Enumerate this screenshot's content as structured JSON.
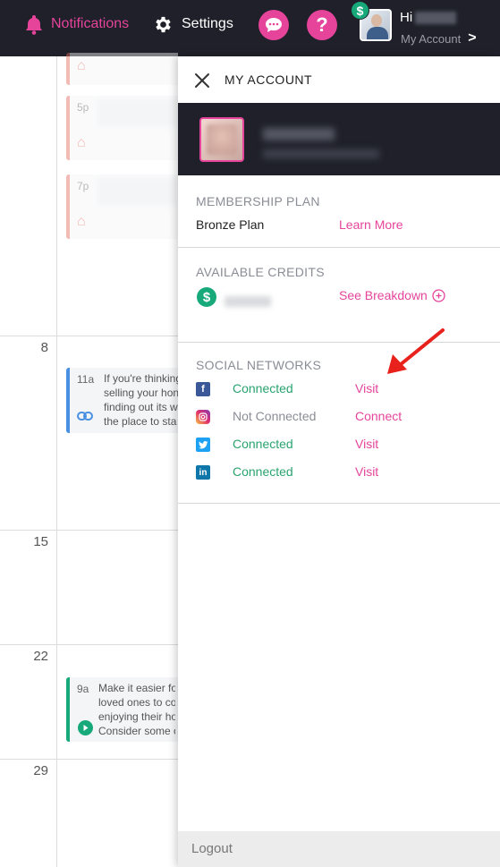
{
  "topbar": {
    "notifications_label": "Notifications",
    "settings_label": "Settings",
    "greeting": "Hi",
    "my_account_label": "My Account",
    "help_symbol": "?",
    "dollar_symbol": "$",
    "chevron_symbol": ">"
  },
  "calendar": {
    "days": [
      "8",
      "15",
      "22",
      "29"
    ],
    "events": [
      {
        "time": "5p",
        "icon": "home-icon"
      },
      {
        "time": "7p",
        "icon": "home-icon"
      },
      {
        "time": "11a",
        "icon": "link-icon",
        "lines": [
          "If you're thinking",
          "selling your hon",
          "finding out its w",
          "the place to sta"
        ],
        "color": "#4a90e2"
      },
      {
        "time": "9a",
        "icon": "play-icon",
        "lines": [
          "Make it easier fo",
          "loved ones to cor",
          "enjoying their hor",
          "Consider some o"
        ],
        "color": "#17a97a"
      }
    ]
  },
  "panel": {
    "title": "MY ACCOUNT",
    "membership": {
      "heading": "MEMBERSHIP PLAN",
      "plan": "Bronze Plan",
      "link": "Learn More"
    },
    "credits": {
      "heading": "AVAILABLE CREDITS",
      "link": "See Breakdown"
    },
    "social": {
      "heading": "SOCIAL NETWORKS",
      "networks": [
        {
          "name": "facebook",
          "status": "Connected",
          "action": "Visit"
        },
        {
          "name": "instagram",
          "status": "Not Connected",
          "action": "Connect"
        },
        {
          "name": "twitter",
          "status": "Connected",
          "action": "Visit"
        },
        {
          "name": "linkedin",
          "status": "Connected",
          "action": "Visit"
        }
      ]
    },
    "logout": "Logout"
  },
  "colors": {
    "accent": "#e6449b",
    "dark": "#1f2029",
    "green": "#2aa36f",
    "arrow": "#e8211c"
  }
}
